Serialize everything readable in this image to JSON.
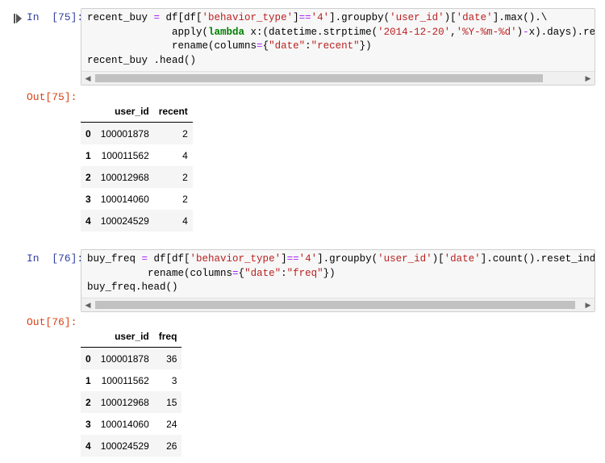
{
  "cells": [
    {
      "in_prompt": "In  [75]:",
      "out_prompt": "Out[75]:",
      "code_lines": [
        [
          [
            "recent_buy ",
            ""
          ],
          [
            "=",
            "op"
          ],
          [
            " df[df[",
            ""
          ],
          [
            "'behavior_type'",
            "str"
          ],
          [
            "]",
            ""
          ],
          [
            "==",
            "op"
          ],
          [
            "'4'",
            "str"
          ],
          [
            "].groupby(",
            ""
          ],
          [
            "'user_id'",
            "str"
          ],
          [
            ")[",
            ""
          ],
          [
            "'date'",
            "str"
          ],
          [
            "].max().\\",
            ""
          ]
        ],
        [
          [
            "              apply(",
            ""
          ],
          [
            "lambda",
            "kw"
          ],
          [
            " x:(datetime.strptime(",
            ""
          ],
          [
            "'2014-12-20'",
            "str"
          ],
          [
            ",",
            ""
          ],
          [
            "'%Y-%m-%d'",
            "str"
          ],
          [
            ")",
            ""
          ],
          [
            "-",
            "op"
          ],
          [
            "x).days).reset_in",
            ""
          ]
        ],
        [
          [
            "              rename(columns",
            ""
          ],
          [
            "=",
            "op"
          ],
          [
            "{",
            ""
          ],
          [
            "\"date\"",
            "str"
          ],
          [
            ":",
            ""
          ],
          [
            "\"recent\"",
            "str"
          ],
          [
            "})",
            ""
          ]
        ],
        [
          [
            "recent_buy .head()",
            ""
          ]
        ]
      ],
      "table": {
        "columns": [
          "",
          "user_id",
          "recent"
        ],
        "rows": [
          [
            "0",
            "100001878",
            "2"
          ],
          [
            "1",
            "100011562",
            "4"
          ],
          [
            "2",
            "100012968",
            "2"
          ],
          [
            "3",
            "100014060",
            "2"
          ],
          [
            "4",
            "100024529",
            "4"
          ]
        ]
      }
    },
    {
      "in_prompt": "In  [76]:",
      "out_prompt": "Out[76]:",
      "code_lines": [
        [
          [
            "buy_freq ",
            ""
          ],
          [
            "=",
            "op"
          ],
          [
            " df[df[",
            ""
          ],
          [
            "'behavior_type'",
            "str"
          ],
          [
            "]",
            ""
          ],
          [
            "==",
            "op"
          ],
          [
            "'4'",
            "str"
          ],
          [
            "].groupby(",
            ""
          ],
          [
            "'user_id'",
            "str"
          ],
          [
            ")[",
            ""
          ],
          [
            "'date'",
            "str"
          ],
          [
            "].count().reset_index().",
            ""
          ]
        ],
        [
          [
            "          rename(columns",
            ""
          ],
          [
            "=",
            "op"
          ],
          [
            "{",
            ""
          ],
          [
            "\"date\"",
            "str"
          ],
          [
            ":",
            ""
          ],
          [
            "\"freq\"",
            "str"
          ],
          [
            "})",
            ""
          ]
        ],
        [
          [
            "buy_freq.head()",
            ""
          ]
        ]
      ],
      "table": {
        "columns": [
          "",
          "user_id",
          "freq"
        ],
        "rows": [
          [
            "0",
            "100001878",
            "36"
          ],
          [
            "1",
            "100011562",
            "3"
          ],
          [
            "2",
            "100012968",
            "15"
          ],
          [
            "3",
            "100014060",
            "24"
          ],
          [
            "4",
            "100024529",
            "26"
          ]
        ]
      }
    }
  ],
  "icons": {
    "run": "run-cell-icon",
    "scroll_left": "scroll-left-icon",
    "scroll_right": "scroll-right-icon"
  },
  "colors": {
    "in_prompt": "#303f9f",
    "out_prompt": "#d84315",
    "string": "#ba2121",
    "keyword": "#008000",
    "operator": "#aa22ff"
  }
}
